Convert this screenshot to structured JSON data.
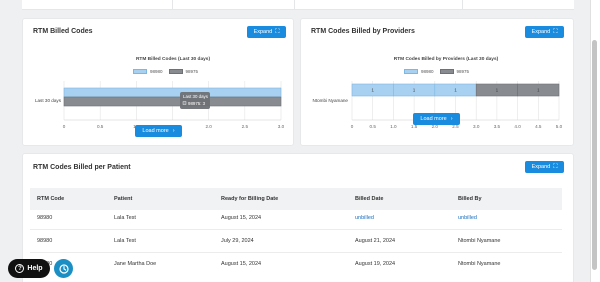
{
  "cards": {
    "billed_codes": {
      "title": "RTM Billed Codes",
      "expand_label": "Expand",
      "chart_title": "RTM Billed Codes (Last 30 days)",
      "load_more": "Load more"
    },
    "by_providers": {
      "title": "RTM Codes Billed by Providers",
      "expand_label": "Expand",
      "chart_title": "RTM Codes Billed by Providers (Last 30 days)",
      "load_more": "Load more"
    },
    "per_patient": {
      "title": "RTM Codes Billed per Patient",
      "expand_label": "Expand"
    }
  },
  "chart_data": [
    {
      "type": "bar",
      "orientation": "horizontal",
      "stacked": true,
      "title": "RTM Billed Codes (Last 30 days)",
      "categories": [
        "Last 30 days"
      ],
      "series": [
        {
          "name": "98980",
          "values": [
            3.0
          ],
          "color": "#a8d0f0"
        },
        {
          "name": "98975",
          "values": [
            3.0
          ],
          "color": "#888c91"
        }
      ],
      "xlim": [
        0,
        3.0
      ],
      "xticks": [
        "0",
        "0.5",
        "1.0",
        "1.5",
        "2.0",
        "2.5",
        "3.0"
      ],
      "tooltip": {
        "title": "Last 30 days",
        "line": "98975: 3"
      },
      "legend": "top"
    },
    {
      "type": "bar",
      "orientation": "horizontal",
      "stacked": true,
      "title": "RTM Codes Billed by Providers (Last 30 days)",
      "categories": [
        "Ntombi Nyamane"
      ],
      "series": [
        {
          "name": "98980",
          "values": [
            3
          ],
          "color": "#a8d0f0",
          "labels": [
            "1",
            "1",
            "1"
          ]
        },
        {
          "name": "98975",
          "values": [
            2
          ],
          "color": "#888c91",
          "labels": [
            "1",
            "1"
          ]
        }
      ],
      "xlim": [
        0,
        5.0
      ],
      "xticks": [
        "0",
        "0.5",
        "1.0",
        "1.5",
        "2.0",
        "2.5",
        "3.0",
        "3.5",
        "4.0",
        "4.5",
        "5.0"
      ],
      "legend": "top"
    }
  ],
  "table": {
    "headers": [
      "RTM Code",
      "Patient",
      "Ready for Billing Date",
      "Billed Date",
      "Billed By"
    ],
    "rows": [
      [
        "98980",
        "Lala Test",
        "August 15, 2024",
        "unbilled",
        "unbilled"
      ],
      [
        "98980",
        "Lala Test",
        "July 29, 2024",
        "August 21, 2024",
        "Ntombi Nyamane"
      ],
      [
        "98980",
        "Jane Martha Doe",
        "August 15, 2024",
        "August 19, 2024",
        "Ntombi Nyamane"
      ]
    ]
  },
  "help": {
    "label": "Help"
  },
  "colors": {
    "accent": "#1a8ce0",
    "series1": "#a8d0f0",
    "series2": "#888c91",
    "link": "#1a6fc0"
  }
}
